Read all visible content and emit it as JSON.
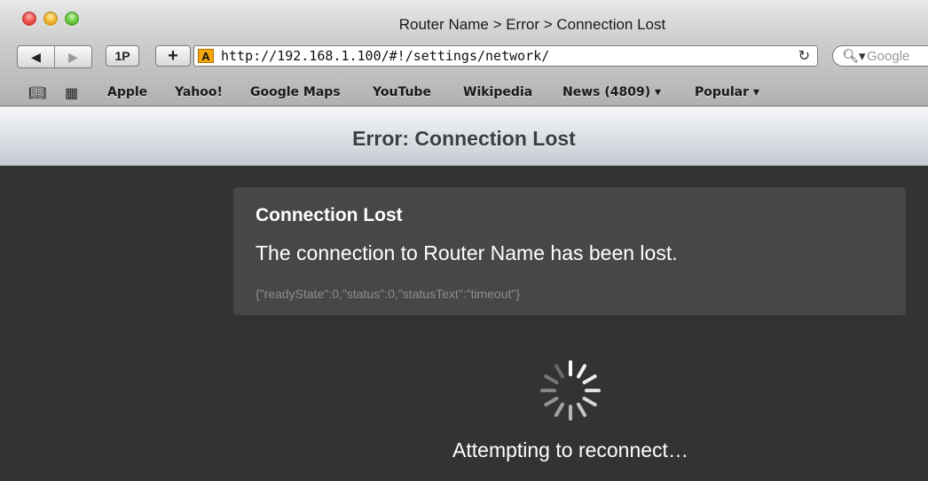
{
  "window": {
    "title": "Router Name > Error > Connection Lost",
    "controls": [
      "close",
      "minimize",
      "zoom"
    ]
  },
  "toolbar": {
    "back_icon": "back-arrow-icon",
    "forward_icon": "forward-arrow-icon",
    "onepassword_label": "1P",
    "add_label": "+",
    "favicon_letter": "A",
    "url": "http://192.168.1.100/#!/settings/network/",
    "reload_icon": "reload-icon",
    "search_placeholder": "Google"
  },
  "bookmarks": {
    "items": [
      "Apple",
      "Yahoo!",
      "Google Maps",
      "YouTube",
      "Wikipedia",
      "News (4809) ▾",
      "Popular ▾"
    ]
  },
  "page": {
    "header_title": "Error: Connection Lost",
    "error": {
      "title": "Connection Lost",
      "message": "The connection to Router Name has been lost.",
      "detail": "{\"readyState\":0,\"status\":0,\"statusText\":\"timeout\"}"
    },
    "status_text": "Attempting to reconnect…"
  },
  "colors": {
    "page_background": "#333333",
    "error_box": "#474747",
    "detail_text": "#8d8d8d"
  }
}
